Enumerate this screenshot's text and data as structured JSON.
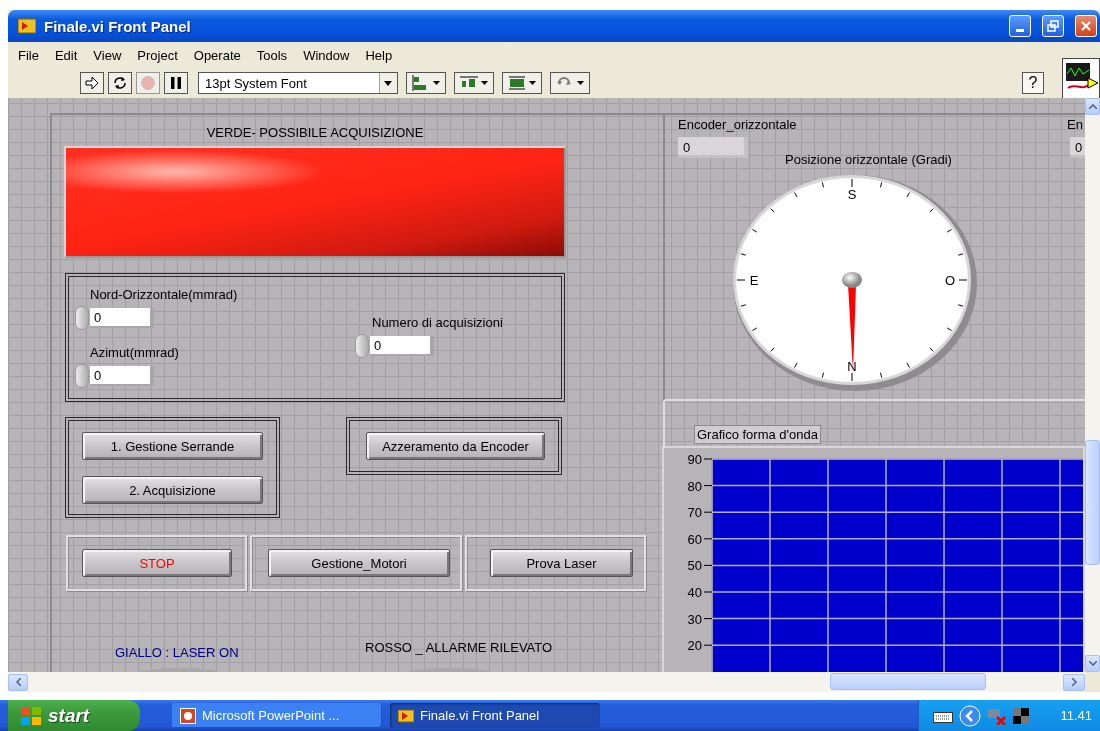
{
  "window": {
    "title": "Finale.vi Front Panel"
  },
  "menu": [
    "File",
    "Edit",
    "View",
    "Project",
    "Operate",
    "Tools",
    "Window",
    "Help"
  ],
  "toolbar": {
    "tools": [
      {
        "kind": "run",
        "disabled": false
      },
      {
        "kind": "run-continuous",
        "disabled": false
      },
      {
        "kind": "abort",
        "disabled": true
      },
      {
        "kind": "pause",
        "disabled": false
      }
    ],
    "font": "13pt System Font",
    "menus": [
      {
        "kind": "align"
      },
      {
        "kind": "distribute"
      },
      {
        "kind": "resize"
      },
      {
        "kind": "reorder"
      }
    ],
    "help": "?"
  },
  "panel": {
    "led": {
      "label": "VERDE- POSSIBILE ACQUISIZIONE",
      "on": true
    },
    "numerics": [
      {
        "label": "Nord-Orizzontale(mmrad)",
        "value": "0"
      },
      {
        "label": "Azimut(mmrad)",
        "value": "0"
      },
      {
        "label": "Numero di acquisizioni",
        "value": "0"
      }
    ],
    "buttons": [
      {
        "label": "1. Gestione Serrande",
        "color": "#000000"
      },
      {
        "label": "2. Acquisizione",
        "color": "#000000"
      },
      {
        "label": "Azzeramento da Encoder",
        "color": "#000000"
      },
      {
        "label": "STOP",
        "color": "#ff0000"
      },
      {
        "label": "Gestione_Motori",
        "color": "#000000"
      },
      {
        "label": "Prova Laser",
        "color": "#000000"
      }
    ],
    "leds": [
      {
        "label": "GIALLO : LASER ON",
        "color": "#000080",
        "on": false
      },
      {
        "label": "ROSSO _ ALLARME RILEVATO",
        "color": "#000000",
        "on": false
      }
    ],
    "encoders": [
      {
        "label": "Encoder_orizzontale",
        "value": "0"
      },
      {
        "label": "En",
        "value": "0"
      }
    ],
    "gauge": {
      "title": "Posizione orizzontale (Gradi)",
      "marks": [
        "S",
        "O",
        "N",
        "E"
      ]
    },
    "chart": {
      "title": "Grafico forma d'onda",
      "y_labels": [
        "90",
        "80",
        "70",
        "60",
        "50",
        "40",
        "30",
        "20"
      ]
    }
  },
  "taskbar": {
    "start": "start",
    "tasks": [
      {
        "label": "Microsoft PowerPoint ...",
        "selected": false
      },
      {
        "label": "Finale.vi Front Panel",
        "selected": true
      }
    ],
    "clock": "11.41"
  }
}
